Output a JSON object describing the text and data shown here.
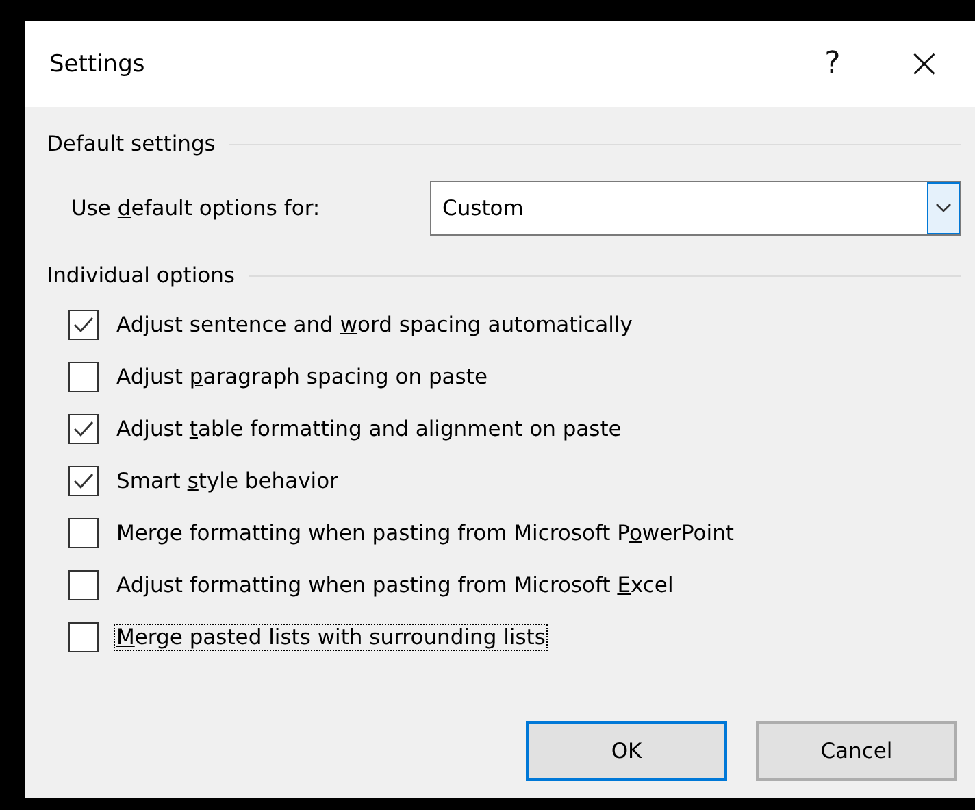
{
  "window": {
    "title": "Settings",
    "help": "?",
    "close": "×"
  },
  "default_settings": {
    "heading": "Default settings",
    "label": {
      "before": "Use ",
      "access_key": "d",
      "after": "efault options for:"
    },
    "dropdown": {
      "value": "Custom"
    }
  },
  "individual_options": {
    "heading": "Individual options",
    "options": [
      {
        "label": {
          "before": "Adjust sentence and ",
          "access_key": "w",
          "after": "ord spacing automatically"
        },
        "checked": true,
        "focused": false
      },
      {
        "label": {
          "before": "Adjust ",
          "access_key": "p",
          "after": "aragraph spacing on paste"
        },
        "checked": false,
        "focused": false
      },
      {
        "label": {
          "before": "Adjust ",
          "access_key": "t",
          "after": "able formatting and alignment on paste"
        },
        "checked": true,
        "focused": false
      },
      {
        "label": {
          "before": "Smart ",
          "access_key": "s",
          "after": "tyle behavior"
        },
        "checked": true,
        "focused": false
      },
      {
        "label": {
          "before": "Merge formatting when pasting from Microsoft P",
          "access_key": "o",
          "after": "werPoint"
        },
        "checked": false,
        "focused": false
      },
      {
        "label": {
          "before": "Adjust formatting when pasting from Microsoft ",
          "access_key": "E",
          "after": "xcel"
        },
        "checked": false,
        "focused": false
      },
      {
        "label": {
          "access_key": "M",
          "after": "erge pasted lists with surrounding lists"
        },
        "checked": false,
        "focused": true
      }
    ]
  },
  "buttons": [
    {
      "label": "OK",
      "default": true
    },
    {
      "label": "Cancel",
      "default": false
    }
  ]
}
